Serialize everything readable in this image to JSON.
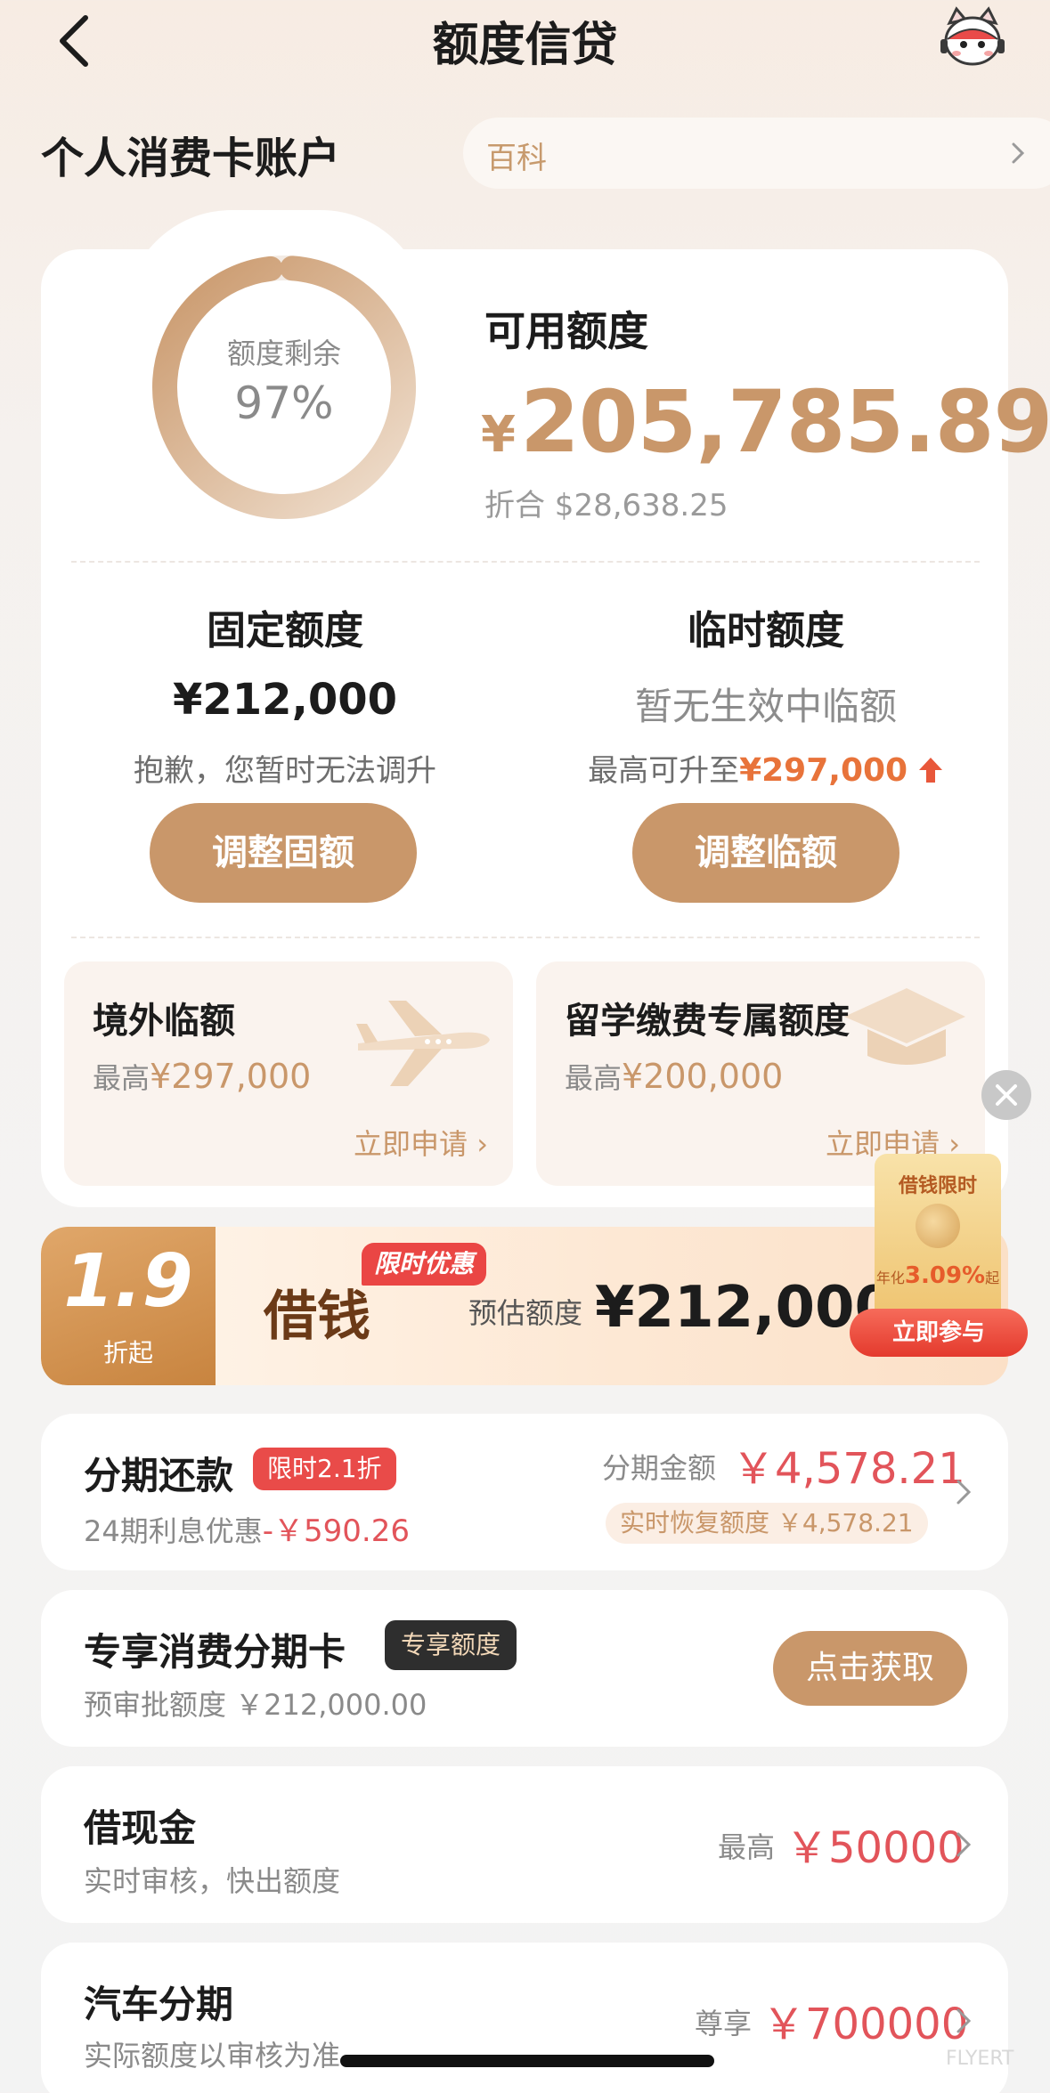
{
  "header": {
    "title": "额度信贷"
  },
  "account": {
    "title": "个人消费卡账户",
    "notice_text": "百科"
  },
  "credit": {
    "ring_label": "额度剩余",
    "ring_value": "97%",
    "ring_fraction": 0.97,
    "available_label": "可用额度",
    "available_currency": "¥",
    "available_amount": "205,785.89",
    "usd_equivalent": "折合 $28,638.25"
  },
  "fixed": {
    "title": "固定额度",
    "value": "¥212,000",
    "note": "抱歉，您暂时无法调升",
    "button": "调整固额"
  },
  "temp": {
    "title": "临时额度",
    "value": "暂无生效中临额",
    "note_prefix": "最高可升至",
    "note_amount": "¥297,000",
    "button": "调整临额"
  },
  "overseas": {
    "title": "境外临额",
    "max_prefix": "最高",
    "max_amount": "¥297,000",
    "link": "立即申请"
  },
  "study": {
    "title": "留学缴费专属额度",
    "max_prefix": "最高",
    "max_amount": "¥200,000",
    "link": "立即申请"
  },
  "loan_banner": {
    "rate": "1.9",
    "rate_sub": "折起",
    "word": "借钱",
    "promo_tag": "限时优惠",
    "est_label": "预估额度",
    "est_amount": "¥212,000"
  },
  "red_packet": {
    "title": "借钱限时",
    "rate_prefix": "年化",
    "rate": "3.09%",
    "rate_suffix": "起",
    "button": "立即参与"
  },
  "installment": {
    "title": "分期还款",
    "tag": "限时2.1折",
    "sub_prefix": "24期利息优惠",
    "sub_amount": "-￥590.26",
    "right_label": "分期金额",
    "right_amount": "￥4,578.21",
    "recover": "实时恢复额度 ￥4,578.21"
  },
  "exclusive_card": {
    "title": "专享消费分期卡",
    "tag": "专享额度",
    "sub": "预审批额度 ￥212,000.00",
    "button": "点击获取"
  },
  "cash": {
    "title": "借现金",
    "sub": "实时审核，快出额度",
    "right_label": "最高",
    "right_amount": "￥50000"
  },
  "car": {
    "title": "汽车分期",
    "sub": "实际额度以审核为准",
    "right_label": "尊享",
    "right_amount": "￥700000"
  },
  "watermark": "FLYERT",
  "colors": {
    "accent": "#c9976a",
    "red": "#e2545a",
    "promo_red": "#e94b49",
    "orange": "#e8733a"
  }
}
